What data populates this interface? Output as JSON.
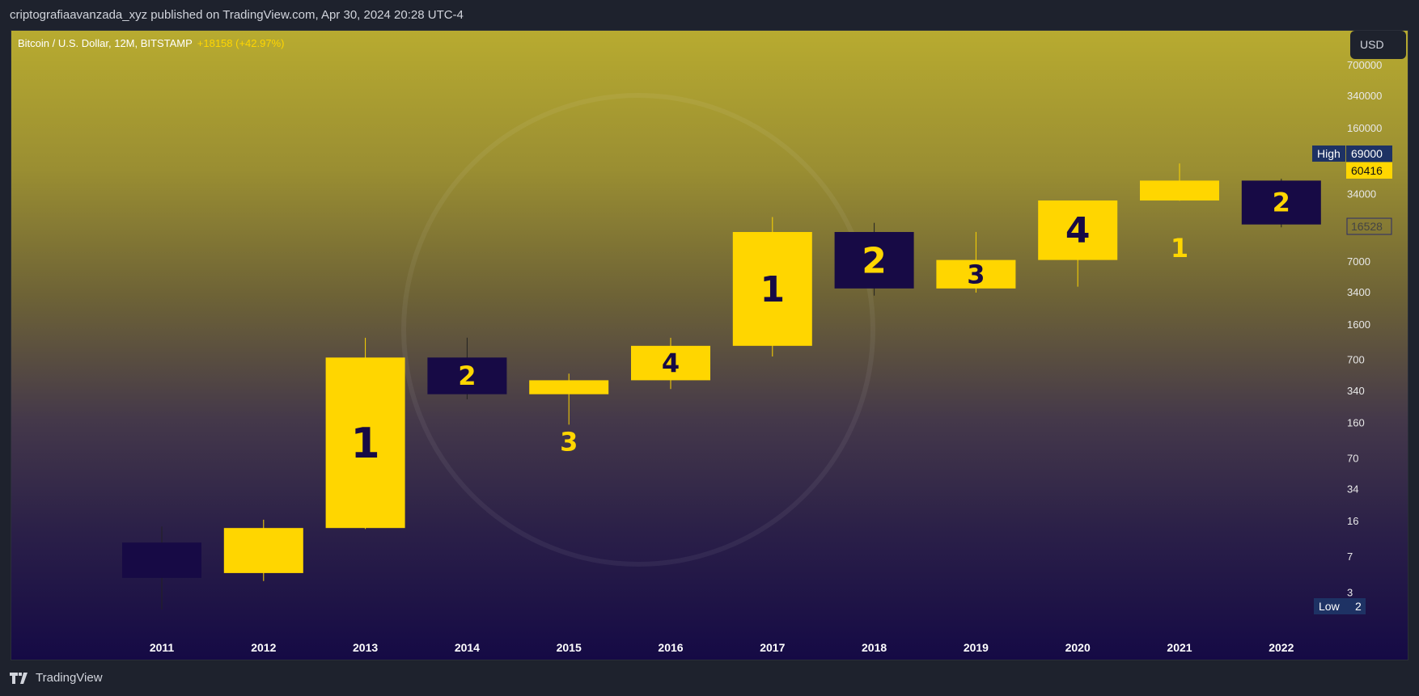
{
  "header": {
    "published": "criptografiaavanzada_xyz published on TradingView.com, Apr 30, 2024 20:28 UTC-4"
  },
  "legend": {
    "symbol": "Bitcoin / U.S. Dollar, 12M, BITSTAMP",
    "change": "+18158 (+42.97%)"
  },
  "currency_button": "USD",
  "footer": {
    "brand": "TradingView",
    "icon": "tradingview-logo-icon"
  },
  "colors": {
    "up": "#ffd600",
    "down": "#170a45",
    "label_on_up": "#170a45",
    "label_on_down": "#ffd600",
    "marker_bg": "#1e3264"
  },
  "chart_data": {
    "type": "candlestick",
    "scale": "log",
    "categories": [
      "2011",
      "2012",
      "2013",
      "2014",
      "2015",
      "2016",
      "2017",
      "2018",
      "2019",
      "2020",
      "2021",
      "2022"
    ],
    "open": [
      9.6,
      4.7,
      13.5,
      732,
      310,
      430,
      963,
      13860,
      3693,
      7195,
      28990,
      46200
    ],
    "high": [
      14,
      16.4,
      1163,
      1165,
      502,
      1163,
      19666,
      17176,
      13880,
      29000,
      69000,
      48240
    ],
    "low": [
      2,
      3.9,
      13.2,
      275,
      152,
      350,
      751,
      3122,
      3350,
      3850,
      28800,
      15460
    ],
    "close": [
      4.2,
      13.5,
      732,
      310,
      430,
      963,
      13860,
      3693,
      7195,
      28990,
      46200,
      16528
    ],
    "annotations": [
      "",
      "",
      "1",
      "2",
      "3",
      "4",
      "1",
      "2",
      "3",
      "4",
      "1",
      "2"
    ],
    "y_ticks": [
      "700000",
      "340000",
      "160000",
      "34000",
      "7000",
      "3400",
      "1600",
      "700",
      "340",
      "160",
      "70",
      "34",
      "16",
      "7",
      "3"
    ],
    "markers": {
      "high_label": "High",
      "high_value": "69000",
      "current": "60416",
      "last_close": "16528",
      "low_label": "Low",
      "low_value": "2"
    }
  }
}
